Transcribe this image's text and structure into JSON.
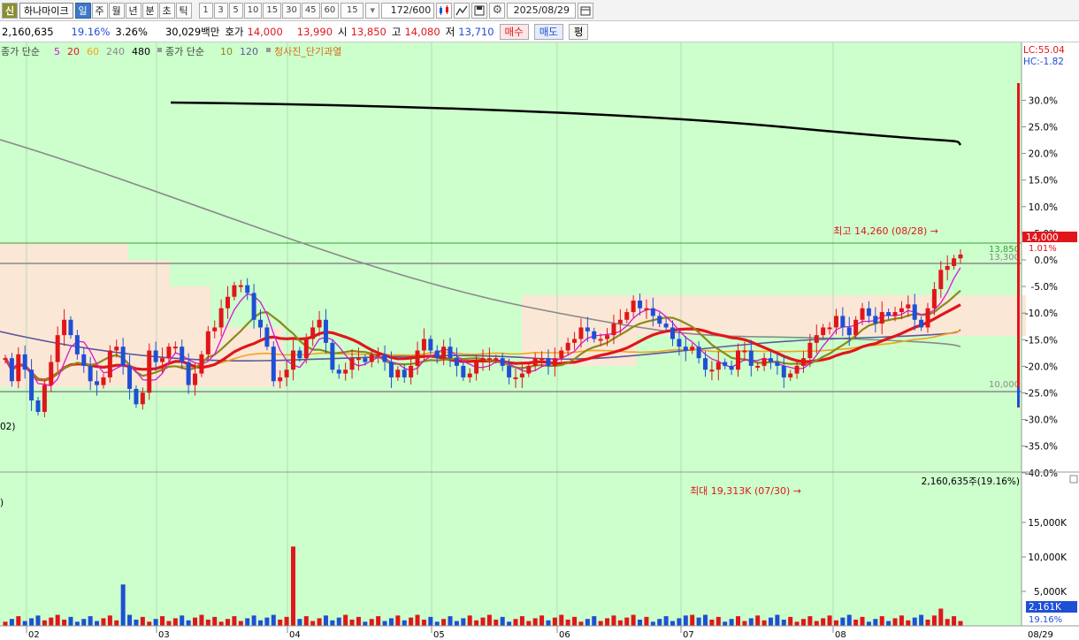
{
  "toolbar": {
    "logo": "신",
    "stock_name": "하나마이크",
    "periods": [
      "일",
      "주",
      "월",
      "년",
      "분",
      "초",
      "틱"
    ],
    "selected_period": "일",
    "intervals": [
      "1",
      "3",
      "5",
      "10",
      "15",
      "30",
      "45",
      "60"
    ],
    "custom_interval": "15",
    "view_count": "172",
    "view_total": "/600",
    "date": "2025/08/29",
    "icons": [
      "candle-settings-icon",
      "tool-icon",
      "save-icon",
      "gear-icon"
    ],
    "pyeong_label": "평"
  },
  "infobar": {
    "volume": "2,160,635",
    "turnover_rate": "19.16%",
    "change_pct": "3.26%",
    "trade_value": "30,029백만",
    "quote_label": "호가",
    "ask": "14,000",
    "bid": "13,990",
    "open_label": "시",
    "open": "13,850",
    "high_label": "고",
    "high": "14,080",
    "low_label": "저",
    "low": "13,710",
    "buy_label": "매수",
    "sell_label": "매도"
  },
  "legend": {
    "ma_price_label": "종가 단순",
    "ma_price_periods": [
      "5",
      "20",
      "60",
      "240",
      "480"
    ],
    "ma_volume_label": "종가 단순",
    "ma_volume_periods": [
      "10",
      "120"
    ],
    "signal_label": "청사진_단기과열"
  },
  "price_panel": {
    "lc_label": "LC:55.04",
    "hc_label": "HC:-1.82",
    "axis_ticks": [
      "30.0%",
      "25.0%",
      "20.0%",
      "15.0%",
      "10.0%",
      "5.0%",
      "0.0%",
      "-5.0%",
      "-10.0%",
      "-15.0%",
      "-20.0%",
      "-25.0%",
      "-30.0%",
      "-35.0%",
      "-40.0%"
    ],
    "current_price_tag": "14,000",
    "current_pct_tag": "1.01%",
    "level_labels": [
      "13,850",
      "13,300",
      "10,000"
    ],
    "max_annotation": "최고 14,260 (08/28)",
    "left_clip_text": "02)",
    "colors": {
      "background": "#ccffcc",
      "up": "#e0161b",
      "down": "#1f4fd4",
      "ma5": "#d418d4",
      "ma20": "#e0161b",
      "ma60": "#f2a31a",
      "ma240": "#8a8a8a",
      "ma480": "#000000",
      "ma10": "#8a8a1a",
      "ma120": "#5a5a9a",
      "bar_zone": "#fbe7d6"
    }
  },
  "volume_panel": {
    "max_annotation": "최대 19,313K (07/30)",
    "total_label": "2,160,635주(19.16%)",
    "axis_ticks": [
      "15,000K",
      "10,000K",
      "5,000K"
    ],
    "current_tag": "2,161K",
    "current_pct": "19.16%",
    "left_clip_text": ")"
  },
  "x_axis": {
    "months": [
      "02",
      "03",
      "04",
      "05",
      "06",
      "07",
      "08"
    ],
    "end_label": "08/29"
  },
  "chart_data": {
    "type": "candlestick",
    "period": "daily",
    "months": [
      "02",
      "03",
      "04",
      "05",
      "06",
      "07",
      "08"
    ],
    "last_bar": {
      "date": "08/29",
      "open": 13850,
      "high": 14080,
      "low": 13710,
      "close": 13990,
      "volume": 2160635
    },
    "annotations": [
      {
        "text": "최고 14,260 (08/28)",
        "value": 14260
      },
      {
        "text": "최대 19,313K (07/30)",
        "value": 19313
      }
    ],
    "price_pct_range": [
      -40,
      30
    ],
    "volume_range_k": [
      0,
      20000
    ],
    "closes": [
      11.3,
      10.7,
      11.4,
      11.0,
      10.2,
      9.9,
      10.6,
      11.2,
      11.9,
      12.3,
      11.9,
      11.4,
      11.1,
      10.7,
      10.6,
      10.8,
      11.5,
      11.6,
      11.1,
      10.5,
      10.1,
      10.4,
      11.5,
      11.2,
      11.3,
      11.6,
      11.6,
      11.2,
      10.6,
      10.9,
      11.4,
      12.0,
      12.1,
      12.6,
      12.9,
      13.2,
      13.2,
      13.0,
      12.3,
      12.1,
      11.6,
      10.7,
      10.8,
      11.0,
      11.5,
      11.3,
      11.8,
      12.1,
      12.3,
      11.7,
      11.0,
      10.9,
      11.0,
      11.3,
      11.3,
      11.2,
      11.4,
      11.4,
      11.2,
      10.8,
      11.0,
      10.8,
      11.1,
      11.5,
      11.8,
      11.5,
      11.3,
      11.6,
      11.3,
      11.1,
      10.8,
      10.9,
      11.2,
      11.3,
      11.3,
      11.3,
      11.1,
      10.8,
      10.8,
      10.9,
      11.1,
      11.3,
      11.3,
      11.1,
      11.3,
      11.5,
      11.7,
      11.8,
      12.1,
      12.0,
      11.8,
      11.8,
      11.9,
      12.2,
      12.3,
      12.5,
      12.8,
      12.6,
      12.6,
      12.4,
      12.2,
      12.1,
      11.8,
      11.6,
      11.5,
      11.6,
      11.3,
      11.0,
      11.0,
      11.2,
      11.1,
      11.0,
      11.5,
      11.5,
      11.1,
      11.1,
      11.3,
      11.2,
      11.1,
      10.8,
      10.9,
      11.1,
      11.3,
      11.7,
      11.9,
      12.1,
      12.1,
      12.4,
      12.1,
      11.9,
      12.3,
      12.6,
      12.4,
      12.2,
      12.5,
      12.4,
      12.5,
      12.6,
      12.7,
      12.3,
      12.1,
      12.6,
      13.1,
      13.6,
      13.7,
      13.9,
      14.0
    ]
  }
}
